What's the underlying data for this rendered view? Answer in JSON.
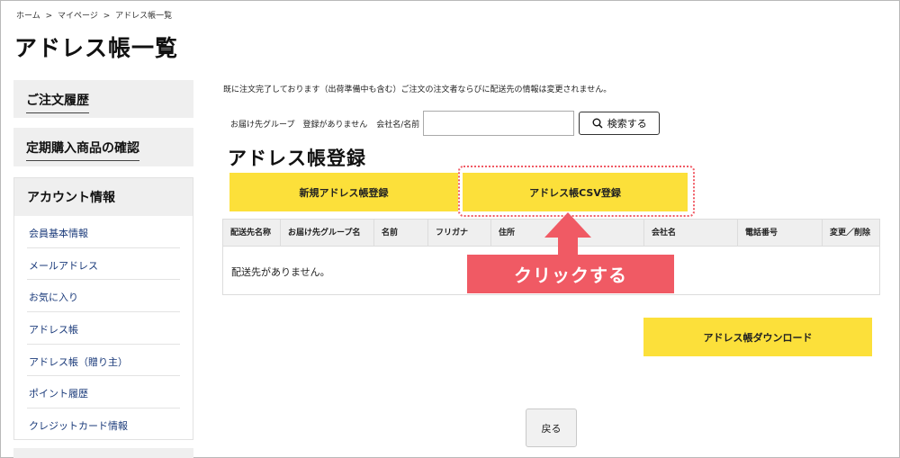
{
  "breadcrumb": [
    "ホーム",
    ">",
    "マイページ",
    ">",
    "アドレス帳一覧"
  ],
  "page_title": "アドレス帳一覧",
  "sidebar": {
    "order_history": "ご注文履歴",
    "subscription": "定期購入商品の確認",
    "account": {
      "title": "アカウント情報",
      "items": [
        "会員基本情報",
        "メールアドレス",
        "お気に入り",
        "アドレス帳",
        "アドレス帳（贈り主）",
        "ポイント履歴",
        "クレジットカード情報"
      ]
    }
  },
  "notice": "既に注文完了しております（出荷準備中も含む）ご注文の注文者ならびに配送先の情報は変更されません。",
  "search": {
    "group_label": "お届け先グループ　登録がありません",
    "name_label": "会社名/名前",
    "placeholder": "",
    "button_label": "検索する"
  },
  "section_title": "アドレス帳登録",
  "buttons": {
    "new_entry": "新規アドレス帳登録",
    "csv_register": "アドレス帳CSV登録",
    "download": "アドレス帳ダウンロード",
    "back": "戻る"
  },
  "table": {
    "headers": [
      "配送先名称",
      "お届け先グループ名",
      "名前",
      "フリガナ",
      "住所",
      "会社名",
      "電話番号",
      "変更／削除"
    ],
    "empty_message": "配送先がありません。"
  },
  "callout": {
    "text": "クリックする",
    "color": "#f05a64"
  },
  "colors": {
    "accent_yellow": "#fce03a",
    "highlight_red": "#f05a64"
  }
}
